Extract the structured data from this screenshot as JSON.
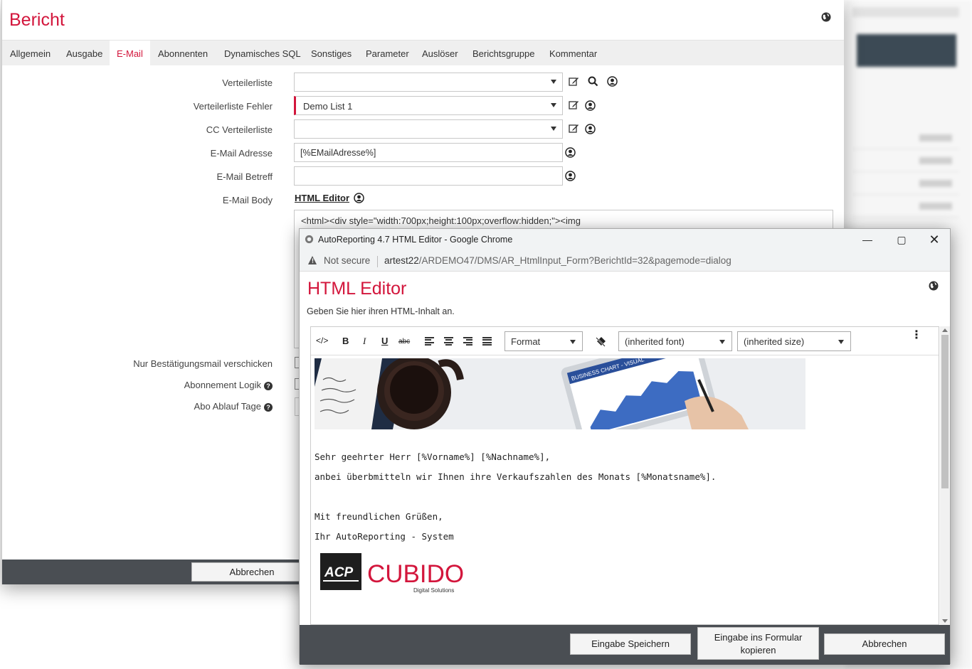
{
  "main": {
    "title": "Bericht",
    "tabs": [
      "Allgemein",
      "Ausgabe",
      "E-Mail",
      "Abonnenten",
      "Dynamisches SQL",
      "Sonstiges",
      "Parameter",
      "Auslöser",
      "Berichtsgruppe",
      "Kommentar"
    ],
    "active_tab": "E-Mail",
    "fields": {
      "verteilerliste": {
        "label": "Verteilerliste",
        "value": ""
      },
      "verteilerliste_fehler": {
        "label": "Verteilerliste Fehler",
        "value": "Demo List 1"
      },
      "cc_verteilerliste": {
        "label": "CC Verteilerliste",
        "value": ""
      },
      "email_adresse": {
        "label": "E-Mail Adresse",
        "value": "[%EMailAdresse%]"
      },
      "email_betreff": {
        "label": "E-Mail Betreff",
        "value": ""
      },
      "email_body": {
        "label": "E-Mail Body",
        "link": "HTML Editor",
        "code": "<html><div style=\"width:700px;height:100px;overflow:hidden;\"><img"
      },
      "nur_bestaetigung": {
        "label": "Nur Bestätigungsmail verschicken"
      },
      "abonnement_logik": {
        "label": "Abonnement Logik"
      },
      "abo_ablauf_tage": {
        "label": "Abo Ablauf Tage"
      }
    },
    "cancel_label": "Abbrechen"
  },
  "popup": {
    "window_title": "AutoReporting 4.7 HTML Editor - Google Chrome",
    "not_secure": "Not secure",
    "url_host": "artest22",
    "url_path": "/ARDEMO47/DMS/AR_HtmlInput_Form?BerichtId=32&pagemode=dialog",
    "title": "HTML Editor",
    "subtitle": "Geben Sie hier ihren HTML-Inhalt an.",
    "toolbar": {
      "format": "Format",
      "font": "(inherited font)",
      "size": "(inherited size)",
      "bold": "B",
      "italic": "I",
      "underline": "U",
      "strike": "abc",
      "code": "</>"
    },
    "content": {
      "greeting": "Sehr geehrter Herr [%Vorname%] [%Nachname%],",
      "line2": "anbei überbmitteln wir Ihnen ihre Verkaufszahlen des Monats [%Monatsname%].",
      "closing": "Mit freundlichen Grüßen,",
      "signature": "Ihr AutoReporting - System",
      "banner_chart_label": "BUSINESS CHART - VISUAL",
      "logo_acp": "ACP",
      "logo_cubido": "CUBIDO",
      "logo_tagline": "Digital Solutions"
    },
    "buttons": {
      "save": "Eingabe Speichern",
      "copy_line1": "Eingabe ins Formular",
      "copy_line2": "kopieren",
      "cancel": "Abbrechen"
    }
  },
  "colors": {
    "accent": "#d3163c",
    "footer": "#4a4e53"
  }
}
